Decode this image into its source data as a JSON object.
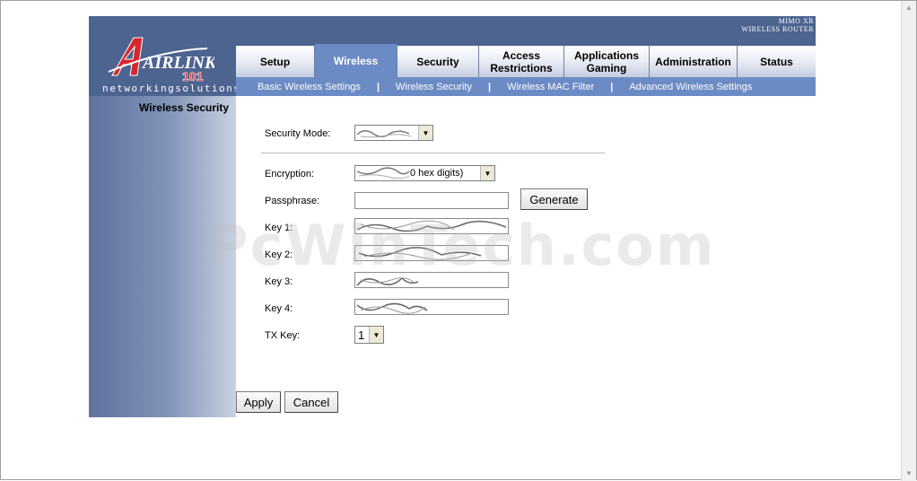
{
  "brand": {
    "logo_text": "AIRLINK",
    "logo_badge": "101",
    "tagline": "networkingsolutions",
    "product_line1": "MIMO XR",
    "product_line2": "WIRELESS ROUTER"
  },
  "tabs": [
    {
      "label": "Setup",
      "active": false
    },
    {
      "label": "Wireless",
      "active": true
    },
    {
      "label": "Security",
      "active": false
    },
    {
      "label": "Access Restrictions",
      "active": false
    },
    {
      "label": "Applications Gaming",
      "active": false
    },
    {
      "label": "Administration",
      "active": false
    },
    {
      "label": "Status",
      "active": false
    }
  ],
  "subnav": [
    "Basic Wireless Settings",
    "Wireless Security",
    "Wireless MAC Filter",
    "Advanced Wireless Settings"
  ],
  "sidebar": {
    "title": "Wireless Security"
  },
  "form": {
    "security_mode_label": "Security Mode:",
    "encryption_label": "Encryption:",
    "encryption_value_suffix": "0 hex digits)",
    "passphrase_label": "Passphrase:",
    "passphrase_value": "",
    "generate_label": "Generate",
    "key1_label": "Key 1:",
    "key2_label": "Key 2:",
    "key3_label": "Key 3:",
    "key4_label": "Key 4:",
    "tx_key_label": "TX Key:",
    "tx_key_value": "1"
  },
  "actions": {
    "apply_label": "Apply",
    "cancel_label": "Cancel"
  },
  "watermark": "PcWinTech.com",
  "colors": {
    "header": "#4d6390",
    "active_tab": "#6b8bc5",
    "subnav": "#6b8bc5",
    "logo_red": "#d8262d"
  }
}
